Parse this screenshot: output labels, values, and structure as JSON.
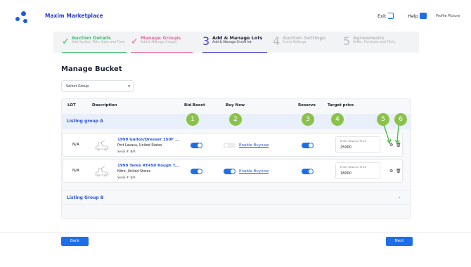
{
  "header": {
    "brand": "Maxim Marketplace",
    "exit_label": "Exit",
    "help_label": "Help",
    "profile_alt": "Profile Picture"
  },
  "steps": [
    {
      "marker": "✓",
      "title": "Auction Details",
      "subtitle": "Add Auction Title, Date and Time",
      "state": "done",
      "color": "#3cba6b"
    },
    {
      "marker": "✓",
      "title": "Manage Groups",
      "subtitle": "Add & Manage Groups",
      "state": "done",
      "color": "#e56a9c"
    },
    {
      "marker": "3",
      "title": "Add & Manage Lots",
      "subtitle": "Add & Manage Event lot",
      "state": "active",
      "color": "#4b3fd8"
    },
    {
      "marker": "4",
      "title": "Auction Settings",
      "subtitle": "Event Settings",
      "state": "todo",
      "color": "#b9bcc4"
    },
    {
      "marker": "5",
      "title": "Agreements",
      "subtitle": "Seller, Purchase and T&Cs",
      "state": "todo",
      "color": "#b9bcc4"
    }
  ],
  "page_title": "Manage Bucket",
  "group_select": {
    "value": "Select Group"
  },
  "table": {
    "headers": {
      "lot": "LOT",
      "description": "Description",
      "bid_boost": "Bid Boost",
      "buy_now": "Buy Now",
      "reserve": "Reserve",
      "target_price": "Target price"
    },
    "groups": [
      {
        "name": "Listing group A",
        "expanded": true,
        "rows": [
          {
            "lot": "N/A",
            "name": "1999 Gallon/Dresser 150F ...",
            "location": "Port Lavaca, United States",
            "serial": "Serial #: N/A",
            "bid_boost": true,
            "buy_now": false,
            "buy_now_label": "Enable Buynow",
            "reserve": true,
            "price_label": "Enter Reserve Price",
            "price_value": "25000"
          },
          {
            "lot": "N/A",
            "name": "1999 Terex RT450 Rough T...",
            "location": "Nitro, United States",
            "serial": "Serial #: N/A",
            "bid_boost": true,
            "buy_now": true,
            "buy_now_label": "Enable Buynow",
            "reserve": true,
            "price_label": "Enter Reserve Price",
            "price_value": "18000"
          }
        ]
      },
      {
        "name": "Listing Group B",
        "expanded": false
      }
    ]
  },
  "callouts": [
    "1",
    "2",
    "3",
    "4",
    "5",
    "6"
  ],
  "footer": {
    "back_label": "Back",
    "next_label": "Next"
  },
  "colors": {
    "primary": "#1d6fe8",
    "callout": "#8bc34a",
    "link": "#2b55d6"
  }
}
